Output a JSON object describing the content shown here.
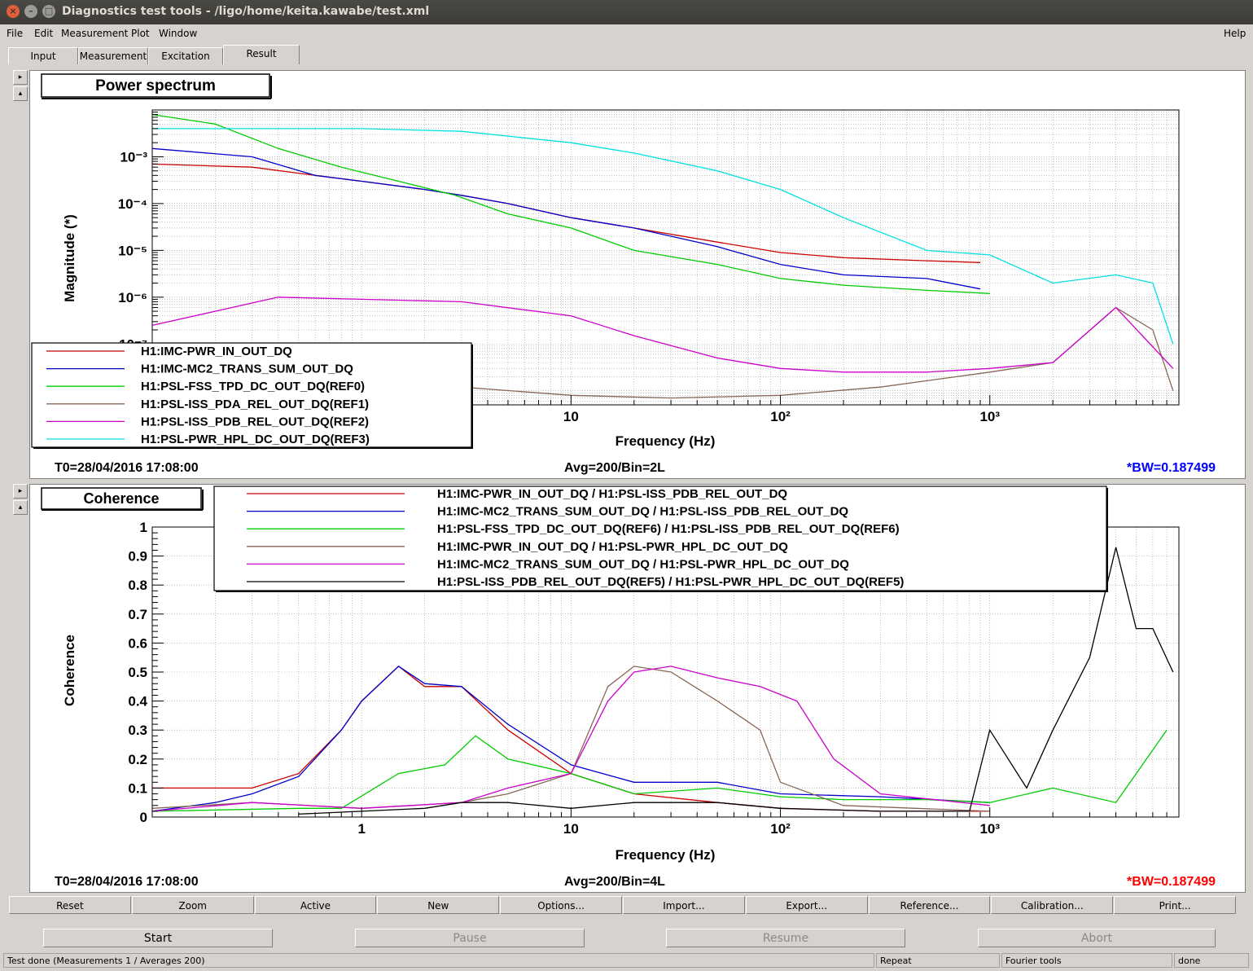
{
  "window": {
    "title": "Diagnostics test tools - /ligo/home/keita.kawabe/test.xml"
  },
  "menu": {
    "file": "File",
    "edit": "Edit",
    "measurement": "Measurement",
    "plot": "Plot",
    "window": "Window",
    "help": "Help"
  },
  "tabs": [
    "Input",
    "Measurement",
    "Excitation",
    "Result"
  ],
  "colors": {
    "red": "#cc0000",
    "blue": "#0000cc",
    "green": "#00cc00",
    "brown": "#886655",
    "magenta": "#cc00cc",
    "cyan": "#00e0e0",
    "black": "#000000"
  },
  "power_plot": {
    "label": "Power spectrum",
    "t0": "T0=28/04/2016 17:08:00",
    "avg": "Avg=200/Bin=2L",
    "bw": "*BW=0.187499"
  },
  "coherence_plot": {
    "label": "Coherence",
    "t0": "T0=28/04/2016 17:08:00",
    "avg": "Avg=200/Bin=4L",
    "bw": "*BW=0.187499"
  },
  "chart_data": [
    {
      "type": "line",
      "title": "Power spectrum",
      "xlabel": "Frequency (Hz)",
      "ylabel": "Magnitude (*)",
      "xscale": "log",
      "yscale": "log",
      "xlim": [
        0.1,
        8000
      ],
      "ylim": [
        5e-09,
        0.01
      ],
      "grid": true,
      "legend_position": "bottom-left",
      "xtick_labels": [
        "10",
        "10²",
        "10³"
      ],
      "ytick_labels": [
        "10⁻³",
        "10⁻⁴",
        "10⁻⁵",
        "10⁻⁶",
        "10⁻⁷"
      ],
      "series": [
        {
          "name": "H1:IMC-PWR_IN_OUT_DQ",
          "color": "red",
          "x": [
            0.1,
            0.3,
            0.6,
            1,
            2,
            3,
            5,
            10,
            20,
            50,
            100,
            200,
            500,
            900
          ],
          "y": [
            0.0007,
            0.0006,
            0.0004,
            0.0003,
            0.0002,
            0.00015,
            0.0001,
            5e-05,
            3e-05,
            1.5e-05,
            9e-06,
            7e-06,
            6e-06,
            5.5e-06
          ]
        },
        {
          "name": "H1:IMC-MC2_TRANS_SUM_OUT_DQ",
          "color": "blue",
          "x": [
            0.1,
            0.3,
            0.6,
            1,
            2,
            3,
            5,
            10,
            20,
            50,
            100,
            200,
            500,
            900
          ],
          "y": [
            0.0015,
            0.001,
            0.0004,
            0.0003,
            0.0002,
            0.00015,
            0.0001,
            5e-05,
            3e-05,
            1.2e-05,
            5e-06,
            3e-06,
            2.5e-06,
            1.5e-06
          ]
        },
        {
          "name": "H1:PSL-FSS_TPD_DC_OUT_DQ(REF0)",
          "color": "green",
          "x": [
            0.1,
            0.2,
            0.4,
            0.8,
            1.5,
            2.8,
            5,
            10,
            20,
            50,
            100,
            200,
            500,
            1000
          ],
          "y": [
            0.008,
            0.005,
            0.0015,
            0.0006,
            0.0003,
            0.00015,
            6e-05,
            3e-05,
            1e-05,
            5e-06,
            2.5e-06,
            1.8e-06,
            1.4e-06,
            1.2e-06
          ]
        },
        {
          "name": "H1:PSL-ISS_PDA_REL_OUT_DQ(REF1)",
          "color": "brown",
          "x": [
            0.1,
            0.3,
            0.6,
            1,
            3,
            10,
            30,
            100,
            300,
            1000,
            2000,
            4000,
            6000,
            7500
          ],
          "y": [
            8e-08,
            1e-07,
            5e-08,
            2e-08,
            1.2e-08,
            8e-09,
            7e-09,
            8e-09,
            1.2e-08,
            2.5e-08,
            4e-08,
            6e-07,
            2e-07,
            1e-08
          ]
        },
        {
          "name": "H1:PSL-ISS_PDB_REL_OUT_DQ(REF2)",
          "color": "magenta",
          "x": [
            0.1,
            0.2,
            0.4,
            1,
            3,
            10,
            20,
            50,
            100,
            200,
            500,
            1000,
            2000,
            4000,
            7500
          ],
          "y": [
            2.5e-07,
            5e-07,
            1e-06,
            9e-07,
            8e-07,
            4e-07,
            1.5e-07,
            5e-08,
            3e-08,
            2.5e-08,
            2.5e-08,
            3e-08,
            4e-08,
            6e-07,
            3e-08
          ]
        },
        {
          "name": "H1:PSL-PWR_HPL_DC_OUT_DQ(REF3)",
          "color": "cyan",
          "x": [
            0.1,
            1,
            3,
            10,
            20,
            50,
            100,
            200,
            500,
            1000,
            2000,
            4000,
            6000,
            7500
          ],
          "y": [
            0.004,
            0.004,
            0.0035,
            0.002,
            0.0012,
            0.0005,
            0.0002,
            5e-05,
            1e-05,
            8e-06,
            2e-06,
            3e-06,
            2e-06,
            1e-07
          ]
        }
      ]
    },
    {
      "type": "line",
      "title": "Coherence",
      "xlabel": "Frequency (Hz)",
      "ylabel": "Coherence",
      "xscale": "log",
      "xlim": [
        0.1,
        8000
      ],
      "ylim": [
        0,
        1
      ],
      "grid": true,
      "legend_position": "top-center",
      "xtick_labels": [
        "1",
        "10",
        "10²",
        "10³"
      ],
      "ytick_labels": [
        "0",
        "0.1",
        "0.2",
        "0.3",
        "0.4",
        "0.5",
        "0.6",
        "0.7",
        "0.8",
        "0.9",
        "1"
      ],
      "series": [
        {
          "name": "H1:IMC-PWR_IN_OUT_DQ / H1:PSL-ISS_PDB_REL_OUT_DQ",
          "color": "red",
          "x": [
            0.1,
            0.2,
            0.3,
            0.5,
            0.8,
            1,
            1.5,
            2,
            3,
            5,
            10,
            20,
            50,
            100,
            300,
            1000
          ],
          "y": [
            0.1,
            0.1,
            0.1,
            0.15,
            0.3,
            0.4,
            0.52,
            0.45,
            0.45,
            0.3,
            0.15,
            0.08,
            0.05,
            0.03,
            0.02,
            0.02
          ]
        },
        {
          "name": "H1:IMC-MC2_TRANS_SUM_OUT_DQ / H1:PSL-ISS_PDB_REL_OUT_DQ",
          "color": "blue",
          "x": [
            0.1,
            0.2,
            0.3,
            0.5,
            0.8,
            1,
            1.5,
            2,
            3,
            5,
            10,
            20,
            50,
            100,
            300,
            1000
          ],
          "y": [
            0.02,
            0.05,
            0.08,
            0.14,
            0.3,
            0.4,
            0.52,
            0.46,
            0.45,
            0.32,
            0.18,
            0.12,
            0.12,
            0.08,
            0.07,
            0.05
          ]
        },
        {
          "name": "H1:PSL-FSS_TPD_DC_OUT_DQ(REF6) / H1:PSL-ISS_PDB_REL_OUT_DQ(REF6)",
          "color": "green",
          "x": [
            0.1,
            0.5,
            0.8,
            1.5,
            2.5,
            3.5,
            5,
            10,
            20,
            50,
            100,
            200,
            500,
            1000,
            2000,
            4000,
            7000
          ],
          "y": [
            0.02,
            0.03,
            0.03,
            0.15,
            0.18,
            0.28,
            0.2,
            0.15,
            0.08,
            0.1,
            0.07,
            0.06,
            0.06,
            0.05,
            0.1,
            0.05,
            0.3
          ]
        },
        {
          "name": "H1:IMC-PWR_IN_OUT_DQ / H1:PSL-PWR_HPL_DC_OUT_DQ",
          "color": "brown",
          "x": [
            0.1,
            0.3,
            1,
            3,
            5,
            10,
            15,
            20,
            30,
            50,
            80,
            100,
            200,
            1000
          ],
          "y": [
            0.03,
            0.05,
            0.03,
            0.05,
            0.08,
            0.15,
            0.45,
            0.52,
            0.5,
            0.4,
            0.3,
            0.12,
            0.04,
            0.02
          ]
        },
        {
          "name": "H1:IMC-MC2_TRANS_SUM_OUT_DQ / H1:PSL-PWR_HPL_DC_OUT_DQ",
          "color": "magenta",
          "x": [
            0.1,
            0.3,
            1,
            3,
            5,
            10,
            15,
            20,
            30,
            50,
            80,
            120,
            180,
            300,
            1000
          ],
          "y": [
            0.02,
            0.05,
            0.03,
            0.05,
            0.1,
            0.15,
            0.4,
            0.5,
            0.52,
            0.48,
            0.45,
            0.4,
            0.2,
            0.08,
            0.04
          ]
        },
        {
          "name": "H1:PSL-ISS_PDB_REL_OUT_DQ(REF5) / H1:PSL-PWR_HPL_DC_OUT_DQ(REF5)",
          "color": "black",
          "x": [
            0.5,
            1,
            2,
            3,
            5,
            10,
            20,
            50,
            100,
            300,
            800,
            1000,
            1500,
            2000,
            3000,
            4000,
            5000,
            6000,
            7500
          ],
          "y": [
            0.01,
            0.02,
            0.03,
            0.05,
            0.05,
            0.03,
            0.05,
            0.05,
            0.03,
            0.02,
            0.02,
            0.3,
            0.1,
            0.3,
            0.55,
            0.93,
            0.65,
            0.65,
            0.5
          ]
        }
      ]
    }
  ],
  "buttons": [
    "Reset",
    "Zoom",
    "Active",
    "New",
    "Options...",
    "Import...",
    "Export...",
    "Reference...",
    "Calibration...",
    "Print..."
  ],
  "controls": {
    "start": "Start",
    "pause": "Pause",
    "resume": "Resume",
    "abort": "Abort"
  },
  "status": {
    "message": "Test done (Measurements 1 / Averages 200)",
    "repeat": "Repeat",
    "fourier": "Fourier tools",
    "state": "done"
  }
}
